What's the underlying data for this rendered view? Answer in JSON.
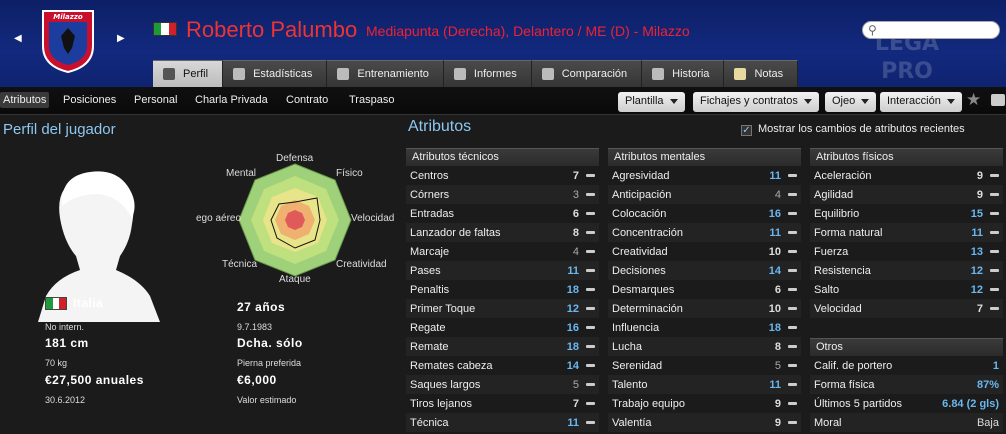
{
  "header": {
    "club_crest_text": "Milazzo",
    "player_name": "Roberto Palumbo",
    "player_desc": "Mediapunta (Derecha), Delantero / ME (D) - Milazzo",
    "flag_colors": [
      "#1f9a3a",
      "#ffffff",
      "#d2202a"
    ],
    "watermark": "LEGA PRO"
  },
  "tabs": [
    {
      "label": "Perfil",
      "icon": "profile-icon"
    },
    {
      "label": "Estadísticas",
      "icon": "stats-icon"
    },
    {
      "label": "Entrenamiento",
      "icon": "training-icon"
    },
    {
      "label": "Informes",
      "icon": "report-icon"
    },
    {
      "label": "Comparación",
      "icon": "compare-icon"
    },
    {
      "label": "Historia",
      "icon": "history-icon"
    },
    {
      "label": "Notas",
      "icon": "notes-icon"
    }
  ],
  "subnav": {
    "items": [
      "Atributos",
      "Posiciones",
      "Personal",
      "Charla Privada",
      "Contrato",
      "Traspaso"
    ],
    "dropdowns": [
      "Plantilla",
      "Fichajes y contratos",
      "Ojeo",
      "Interacción"
    ]
  },
  "profile": {
    "title": "Perfil del jugador",
    "radar_labels": {
      "top": "Defensa",
      "top_right": "Físico",
      "right": "Velocidad",
      "bottom_right": "Creatividad",
      "bottom": "Ataque",
      "bottom_left": "Técnica",
      "left": "ego aéreo",
      "top_left": "Mental"
    },
    "nationality": "Italia",
    "intl": "No intern.",
    "age": "27 años",
    "dob": "9.7.1983",
    "height": "181 cm",
    "weight": "70 kg",
    "foot": "Dcha. sólo",
    "foot_label": "Pierna preferida",
    "wage": "€27,500 anuales",
    "contract_end": "30.6.2012",
    "value": "€6,000",
    "value_label": "Valor estimado"
  },
  "attributes": {
    "title": "Atributos",
    "recent_label": "Mostrar los cambios de atributos recientes",
    "recent_checked": true,
    "technical": {
      "title": "Atributos técnicos",
      "rows": [
        {
          "name": "Centros",
          "value": "7",
          "tone": "mid"
        },
        {
          "name": "Córners",
          "value": "3",
          "tone": "lo"
        },
        {
          "name": "Entradas",
          "value": "6",
          "tone": "mid"
        },
        {
          "name": "Lanzador de faltas",
          "value": "8",
          "tone": "mid"
        },
        {
          "name": "Marcaje",
          "value": "4",
          "tone": "lo"
        },
        {
          "name": "Pases",
          "value": "11",
          "tone": "hi"
        },
        {
          "name": "Penaltis",
          "value": "18",
          "tone": "hi"
        },
        {
          "name": "Primer Toque",
          "value": "12",
          "tone": "hi"
        },
        {
          "name": "Regate",
          "value": "16",
          "tone": "hi"
        },
        {
          "name": "Remate",
          "value": "18",
          "tone": "hi"
        },
        {
          "name": "Remates cabeza",
          "value": "14",
          "tone": "hi"
        },
        {
          "name": "Saques largos",
          "value": "5",
          "tone": "lo"
        },
        {
          "name": "Tiros lejanos",
          "value": "7",
          "tone": "mid"
        },
        {
          "name": "Técnica",
          "value": "11",
          "tone": "hi"
        }
      ]
    },
    "mental": {
      "title": "Atributos mentales",
      "rows": [
        {
          "name": "Agresividad",
          "value": "11",
          "tone": "hi"
        },
        {
          "name": "Anticipación",
          "value": "4",
          "tone": "lo"
        },
        {
          "name": "Colocación",
          "value": "16",
          "tone": "hi"
        },
        {
          "name": "Concentración",
          "value": "11",
          "tone": "hi"
        },
        {
          "name": "Creatividad",
          "value": "10",
          "tone": "mid"
        },
        {
          "name": "Decisiones",
          "value": "14",
          "tone": "hi"
        },
        {
          "name": "Desmarques",
          "value": "6",
          "tone": "mid"
        },
        {
          "name": "Determinación",
          "value": "10",
          "tone": "mid"
        },
        {
          "name": "Influencia",
          "value": "18",
          "tone": "hi"
        },
        {
          "name": "Lucha",
          "value": "8",
          "tone": "mid"
        },
        {
          "name": "Serenidad",
          "value": "5",
          "tone": "lo"
        },
        {
          "name": "Talento",
          "value": "11",
          "tone": "hi"
        },
        {
          "name": "Trabajo equipo",
          "value": "9",
          "tone": "mid"
        },
        {
          "name": "Valentía",
          "value": "9",
          "tone": "mid"
        }
      ]
    },
    "physical": {
      "title": "Atributos físicos",
      "rows": [
        {
          "name": "Aceleración",
          "value": "9",
          "tone": "mid"
        },
        {
          "name": "Agilidad",
          "value": "9",
          "tone": "mid"
        },
        {
          "name": "Equilibrio",
          "value": "15",
          "tone": "hi"
        },
        {
          "name": "Forma natural",
          "value": "11",
          "tone": "hi"
        },
        {
          "name": "Fuerza",
          "value": "13",
          "tone": "hi"
        },
        {
          "name": "Resistencia",
          "value": "12",
          "tone": "hi"
        },
        {
          "name": "Salto",
          "value": "12",
          "tone": "hi"
        },
        {
          "name": "Velocidad",
          "value": "7",
          "tone": "mid"
        }
      ]
    },
    "other": {
      "title": "Otros",
      "rows": [
        {
          "name": "Calif. de portero",
          "value": "1"
        },
        {
          "name": "Forma física",
          "value": "87%"
        },
        {
          "name": "Últimos 5 partidos",
          "value": "6.84 (2 gls)"
        },
        {
          "name": "Moral",
          "value": "Baja"
        }
      ]
    }
  }
}
